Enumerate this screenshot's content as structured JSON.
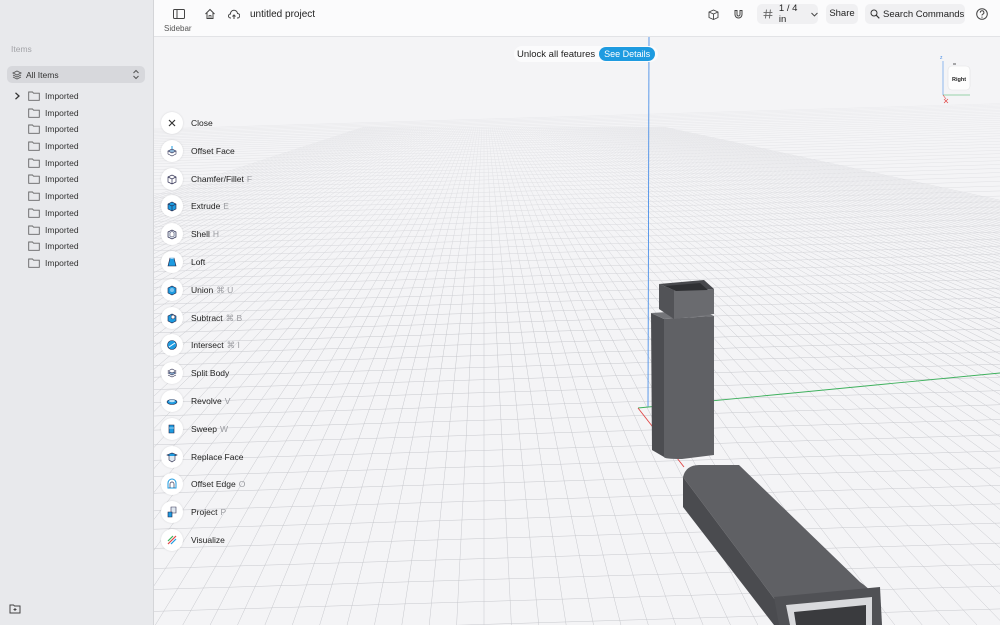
{
  "sidebar": {
    "section_label": "Items",
    "all_items_label": "All Items",
    "tree_items": [
      "Imported",
      "Imported",
      "Imported",
      "Imported",
      "Imported",
      "Imported",
      "Imported",
      "Imported",
      "Imported",
      "Imported",
      "Imported"
    ]
  },
  "toolbar": {
    "sidebar_label": "Sidebar",
    "project_title": "untitled project",
    "grid_size": "1 / 4 in",
    "share_label": "Share",
    "search_label": "Search Commands"
  },
  "viewport": {
    "unlock_text": "Unlock all features",
    "see_details_label": "See Details",
    "viewcube_face": "Right",
    "axis_z_label": "z"
  },
  "tools": [
    {
      "label": "Close",
      "shortcut": "",
      "icon": "close-icon"
    },
    {
      "label": "Offset Face",
      "shortcut": "",
      "icon": "offset-face-icon"
    },
    {
      "label": "Chamfer/Fillet",
      "shortcut": "F",
      "icon": "chamfer-fillet-icon"
    },
    {
      "label": "Extrude",
      "shortcut": "E",
      "icon": "extrude-icon"
    },
    {
      "label": "Shell",
      "shortcut": "H",
      "icon": "shell-icon"
    },
    {
      "label": "Loft",
      "shortcut": "",
      "icon": "loft-icon"
    },
    {
      "label": "Union",
      "shortcut": "⌘ U",
      "icon": "union-icon"
    },
    {
      "label": "Subtract",
      "shortcut": "⌘ B",
      "icon": "subtract-icon"
    },
    {
      "label": "Intersect",
      "shortcut": "⌘ I",
      "icon": "intersect-icon"
    },
    {
      "label": "Split Body",
      "shortcut": "",
      "icon": "split-body-icon"
    },
    {
      "label": "Revolve",
      "shortcut": "V",
      "icon": "revolve-icon"
    },
    {
      "label": "Sweep",
      "shortcut": "W",
      "icon": "sweep-icon"
    },
    {
      "label": "Replace Face",
      "shortcut": "",
      "icon": "replace-face-icon"
    },
    {
      "label": "Offset Edge",
      "shortcut": "O",
      "icon": "offset-edge-icon"
    },
    {
      "label": "Project",
      "shortcut": "P",
      "icon": "project-icon"
    },
    {
      "label": "Visualize",
      "shortcut": "",
      "icon": "visualize-icon"
    }
  ],
  "colors": {
    "accent": "#1e9be0",
    "axis_x": "#e04545",
    "axis_y": "#3db05c",
    "axis_z": "#4a8fe8",
    "model": "#5a5b5f"
  }
}
